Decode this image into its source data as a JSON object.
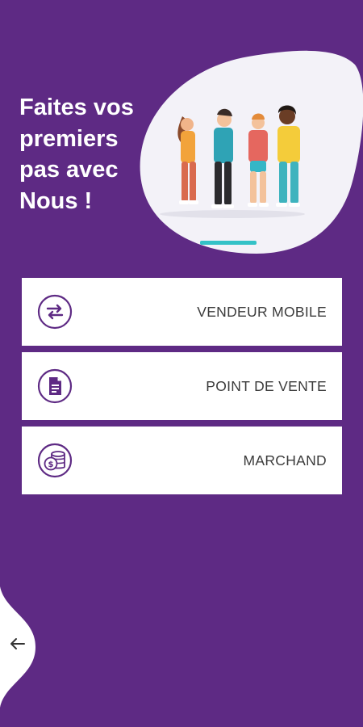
{
  "hero": {
    "title_lines": [
      "Faites vos",
      "premiers",
      "pas avec",
      "Nous !"
    ]
  },
  "menu": {
    "items": [
      {
        "label": "VENDEUR MOBILE",
        "icon": "transfer-arrows-icon"
      },
      {
        "label": "POINT DE VENTE",
        "icon": "document-icon"
      },
      {
        "label": "MARCHAND",
        "icon": "coins-icon"
      }
    ]
  },
  "colors": {
    "background": "#5e2a84",
    "card": "#ffffff",
    "icon_stroke": "#5e2a84",
    "blob": "#f3f2f8",
    "accent_teal": "#34c2c7"
  },
  "back_button": {
    "icon": "arrow-left-icon"
  }
}
